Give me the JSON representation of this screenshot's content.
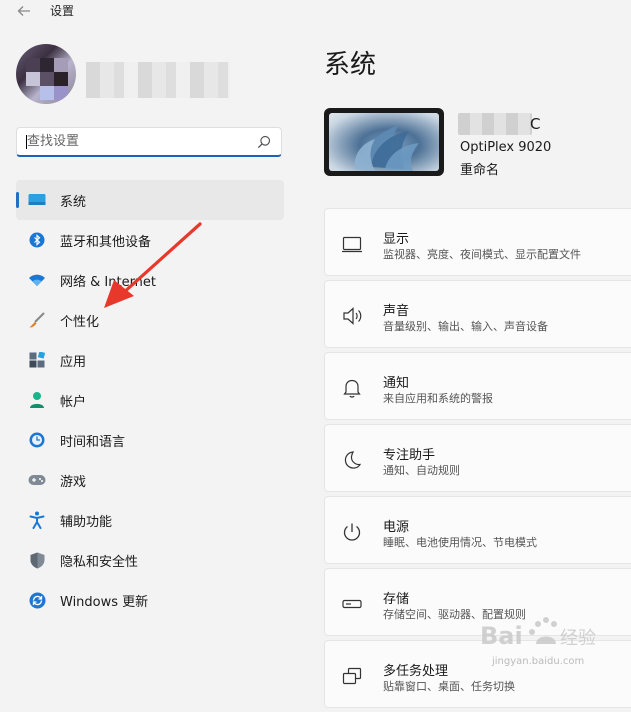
{
  "window": {
    "title": "设置",
    "back_icon": "arrow-left-icon"
  },
  "account": {
    "avatar_icon": "user-avatar-blurred",
    "name_redacted": true
  },
  "search": {
    "placeholder": "查找设置",
    "value": "",
    "icon": "search-icon"
  },
  "nav": {
    "items": [
      {
        "label": "系统",
        "icon": "monitor-icon",
        "selected": true
      },
      {
        "label": "蓝牙和其他设备",
        "icon": "bluetooth-icon",
        "selected": false
      },
      {
        "label": "网络 & Internet",
        "icon": "wifi-icon",
        "selected": false
      },
      {
        "label": "个性化",
        "icon": "brush-icon",
        "selected": false
      },
      {
        "label": "应用",
        "icon": "apps-icon",
        "selected": false
      },
      {
        "label": "帐户",
        "icon": "person-icon",
        "selected": false
      },
      {
        "label": "时间和语言",
        "icon": "globe-clock-icon",
        "selected": false
      },
      {
        "label": "游戏",
        "icon": "gamepad-icon",
        "selected": false
      },
      {
        "label": "辅助功能",
        "icon": "accessibility-icon",
        "selected": false
      },
      {
        "label": "隐私和安全性",
        "icon": "shield-icon",
        "selected": false
      },
      {
        "label": "Windows 更新",
        "icon": "update-icon",
        "selected": false
      }
    ]
  },
  "main": {
    "title": "系统",
    "device": {
      "name_suffix": "C",
      "model": "OptiPlex 9020",
      "rename_label": "重命名"
    },
    "cards": [
      {
        "title": "显示",
        "subtitle": "监视器、亮度、夜间模式、显示配置文件",
        "icon": "display-icon"
      },
      {
        "title": "声音",
        "subtitle": "音量级别、输出、输入、声音设备",
        "icon": "speaker-icon"
      },
      {
        "title": "通知",
        "subtitle": "来自应用和系统的警报",
        "icon": "bell-icon"
      },
      {
        "title": "专注助手",
        "subtitle": "通知、自动规则",
        "icon": "moon-icon"
      },
      {
        "title": "电源",
        "subtitle": "睡眠、电池使用情况、节电模式",
        "icon": "power-icon"
      },
      {
        "title": "存储",
        "subtitle": "存储空间、驱动器、配置规则",
        "icon": "storage-icon"
      },
      {
        "title": "多任务处理",
        "subtitle": "贴靠窗口、桌面、任务切换",
        "icon": "multitask-icon"
      }
    ]
  },
  "annotation": {
    "arrow_color": "#e8382c"
  },
  "watermark": {
    "text": "Baidu 经验",
    "url_text": "jingyan.baidu.com"
  },
  "colors": {
    "accent": "#1f6fc5",
    "background": "#f3f3f3",
    "card": "#fbfbfb"
  }
}
